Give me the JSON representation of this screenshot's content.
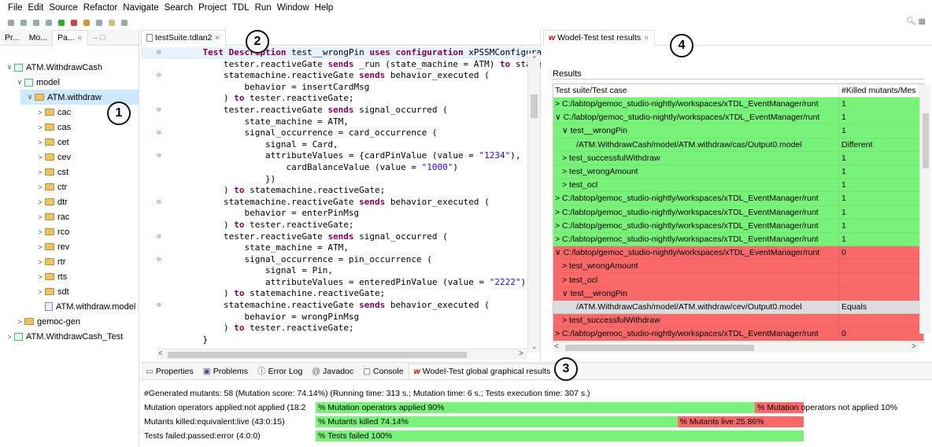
{
  "menu": [
    "File",
    "Edit",
    "Source",
    "Refactor",
    "Navigate",
    "Search",
    "Project",
    "TDL",
    "Run",
    "Window",
    "Help"
  ],
  "explorer": {
    "tabs": [
      "Pr...",
      "Mo...",
      "Pa..."
    ],
    "tree": [
      {
        "label": "ATM.WithdrawCash",
        "indent": 0,
        "chev": "∨",
        "icon": "project"
      },
      {
        "label": "model",
        "indent": 1,
        "chev": "∨",
        "icon": "package"
      },
      {
        "label": "ATM.withdraw",
        "indent": 2,
        "chev": "∨",
        "icon": "folder",
        "selected": true
      },
      {
        "label": "cac",
        "indent": 3,
        "chev": ">",
        "icon": "folder"
      },
      {
        "label": "cas",
        "indent": 3,
        "chev": ">",
        "icon": "folder"
      },
      {
        "label": "cet",
        "indent": 3,
        "chev": ">",
        "icon": "folder"
      },
      {
        "label": "cev",
        "indent": 3,
        "chev": ">",
        "icon": "folder"
      },
      {
        "label": "cst",
        "indent": 3,
        "chev": ">",
        "icon": "folder"
      },
      {
        "label": "ctr",
        "indent": 3,
        "chev": ">",
        "icon": "folder"
      },
      {
        "label": "dtr",
        "indent": 3,
        "chev": ">",
        "icon": "folder"
      },
      {
        "label": "rac",
        "indent": 3,
        "chev": ">",
        "icon": "folder"
      },
      {
        "label": "rco",
        "indent": 3,
        "chev": ">",
        "icon": "folder"
      },
      {
        "label": "rev",
        "indent": 3,
        "chev": ">",
        "icon": "folder"
      },
      {
        "label": "rtr",
        "indent": 3,
        "chev": ">",
        "icon": "folder"
      },
      {
        "label": "rts",
        "indent": 3,
        "chev": ">",
        "icon": "folder"
      },
      {
        "label": "sdt",
        "indent": 3,
        "chev": ">",
        "icon": "folder"
      },
      {
        "label": "ATM.withdraw.model",
        "indent": 3,
        "chev": "",
        "icon": "model"
      },
      {
        "label": "gemoc-gen",
        "indent": 1,
        "chev": ">",
        "icon": "folder"
      },
      {
        "label": "ATM.WithdrawCash_Test",
        "indent": 0,
        "chev": ">",
        "icon": "project"
      }
    ]
  },
  "badges": [
    "1",
    "2",
    "3",
    "4"
  ],
  "editor": {
    "tab": "testSuite.tdlan2",
    "lines": [
      [
        {
          "t": "    "
        },
        {
          "t": "Test Description",
          "k": 1
        },
        {
          "t": " test__wrongPin "
        },
        {
          "t": "uses configuration",
          "k": 1
        },
        {
          "t": " xPSSMConfigurat"
        }
      ],
      [
        {
          "t": "        tester.reactiveGate "
        },
        {
          "t": "sends",
          "k": 1
        },
        {
          "t": " _run (state_machine = ATM) "
        },
        {
          "t": "to",
          "k": 1
        },
        {
          "t": " statem"
        }
      ],
      [
        {
          "t": "        statemachine.reactiveGate "
        },
        {
          "t": "sends",
          "k": 1
        },
        {
          "t": " behavior_executed ("
        }
      ],
      [
        {
          "t": "            behavior = insertCardMsg"
        }
      ],
      [
        {
          "t": "        ) "
        },
        {
          "t": "to",
          "k": 1
        },
        {
          "t": " tester.reactiveGate;"
        }
      ],
      [
        {
          "t": "        tester.reactiveGate "
        },
        {
          "t": "sends",
          "k": 1
        },
        {
          "t": " signal_occurred ("
        }
      ],
      [
        {
          "t": "            state_machine = ATM,"
        }
      ],
      [
        {
          "t": "            signal_occurrence = card_occurrence ("
        }
      ],
      [
        {
          "t": "                signal = Card,"
        }
      ],
      [
        {
          "t": "                attributeValues = {cardPinValue (value = "
        },
        {
          "t": "\"1234\"",
          "s": 1
        },
        {
          "t": "),"
        }
      ],
      [
        {
          "t": "                    cardBalanceValue (value = "
        },
        {
          "t": "\"1000\"",
          "s": 1
        },
        {
          "t": ")"
        }
      ],
      [
        {
          "t": "                })"
        }
      ],
      [
        {
          "t": "        ) "
        },
        {
          "t": "to",
          "k": 1
        },
        {
          "t": " statemachine.reactiveGate;"
        }
      ],
      [
        {
          "t": "        statemachine.reactiveGate "
        },
        {
          "t": "sends",
          "k": 1
        },
        {
          "t": " behavior_executed ("
        }
      ],
      [
        {
          "t": "            behavior = enterPinMsg"
        }
      ],
      [
        {
          "t": "        ) "
        },
        {
          "t": "to",
          "k": 1
        },
        {
          "t": " tester.reactiveGate;"
        }
      ],
      [
        {
          "t": "        tester.reactiveGate "
        },
        {
          "t": "sends",
          "k": 1
        },
        {
          "t": " signal_occurred ("
        }
      ],
      [
        {
          "t": "            state_machine = ATM,"
        }
      ],
      [
        {
          "t": "            signal_occurrence = pin_occurrence ("
        }
      ],
      [
        {
          "t": "                signal = Pin,"
        }
      ],
      [
        {
          "t": "                attributeValues = enteredPinValue (value = "
        },
        {
          "t": "\"2222\"",
          "s": 1
        },
        {
          "t": "))"
        }
      ],
      [
        {
          "t": "        ) "
        },
        {
          "t": "to",
          "k": 1
        },
        {
          "t": " statemachine.reactiveGate;"
        }
      ],
      [
        {
          "t": "        statemachine.reactiveGate "
        },
        {
          "t": "sends",
          "k": 1
        },
        {
          "t": " behavior_executed ("
        }
      ],
      [
        {
          "t": "            behavior = wrongPinMsg"
        }
      ],
      [
        {
          "t": "        ) "
        },
        {
          "t": "to",
          "k": 1
        },
        {
          "t": " tester.reactiveGate;"
        }
      ],
      [
        {
          "t": "    }"
        }
      ]
    ],
    "gutter_marks": [
      0,
      2,
      5,
      7,
      9,
      13,
      16,
      18,
      22
    ]
  },
  "results": {
    "tab": "Wodel-Test test results",
    "section": "Results",
    "col1": "Test suite/Test case",
    "col2": "#Killed mutants/Mes",
    "rows": [
      {
        "c1": "> C:/labtop/gemoc_studio-nightly/workspaces/xTDL_EventManager/runt",
        "c2": "1",
        "color": "g",
        "indent": 0
      },
      {
        "c1": "∨ C:/labtop/gemoc_studio-nightly/workspaces/xTDL_EventManager/runt",
        "c2": "1",
        "color": "g",
        "indent": 0
      },
      {
        "c1": "∨ test__wrongPin",
        "c2": "1",
        "color": "g",
        "indent": 1
      },
      {
        "c1": "/ATM.WithdrawCash/model/ATM.withdraw/cas/Output0.model",
        "c2": "Different",
        "color": "g",
        "indent": 3
      },
      {
        "c1": "> test_successfulWithdraw",
        "c2": "1",
        "color": "g",
        "indent": 1
      },
      {
        "c1": "> test_wrongAmount",
        "c2": "1",
        "color": "g",
        "indent": 1
      },
      {
        "c1": "> test_ocl",
        "c2": "1",
        "color": "g",
        "indent": 1
      },
      {
        "c1": "> C:/labtop/gemoc_studio-nightly/workspaces/xTDL_EventManager/runt",
        "c2": "1",
        "color": "g",
        "indent": 0
      },
      {
        "c1": "> C:/labtop/gemoc_studio-nightly/workspaces/xTDL_EventManager/runt",
        "c2": "1",
        "color": "g",
        "indent": 0
      },
      {
        "c1": "> C:/labtop/gemoc_studio-nightly/workspaces/xTDL_EventManager/runt",
        "c2": "1",
        "color": "g",
        "indent": 0
      },
      {
        "c1": "> C:/labtop/gemoc_studio-nightly/workspaces/xTDL_EventManager/runt",
        "c2": "1",
        "color": "g",
        "indent": 0
      },
      {
        "c1": "∨ C:/labtop/gemoc_studio-nightly/workspaces/xTDL_EventManager/runt",
        "c2": "0",
        "color": "r",
        "indent": 0
      },
      {
        "c1": "> test_wrongAmount",
        "c2": "",
        "color": "r",
        "indent": 1
      },
      {
        "c1": "> test_ocl",
        "c2": "",
        "color": "r",
        "indent": 1
      },
      {
        "c1": "∨ test__wrongPin",
        "c2": "",
        "color": "r",
        "indent": 1
      },
      {
        "c1": "/ATM.WithdrawCash/model/ATM.withdraw/cev/Output0.model",
        "c2": "Equals",
        "color": "gr",
        "indent": 3
      },
      {
        "c1": "> test_successfulWithdraw",
        "c2": "",
        "color": "r",
        "indent": 1
      },
      {
        "c1": "> C:/labtop/gemoc_studio-nightly/workspaces/xTDL_EventManager/runt",
        "c2": "0",
        "color": "r",
        "indent": 0
      }
    ]
  },
  "bottom": {
    "tabs": [
      "Properties",
      "Problems",
      "Error Log",
      "Javadoc",
      "Console",
      "Wodel-Test global graphical results"
    ],
    "summary": "#Generated mutants: 58 (Mutation score: 74.14%) (Running time: 313 s.; Mutation time: 6 s.; Tests execution time: 307 s.)",
    "bars": [
      {
        "label": "Mutation operators applied:not applied (18:2",
        "green_text": "% Mutation operators applied 90%",
        "red_text": "% Mutation operators not applied 10%",
        "green_frac": 0.9
      },
      {
        "label": "Mutants killed:equivalent:live (43:0:15)",
        "green_text": "% Mutants killed 74.14%",
        "red_text": "% Mutants live 25.86%",
        "green_frac": 0.7414
      },
      {
        "label": "Tests failed:passed:error (4:0:0)",
        "green_text": "% Tests failed 100%",
        "red_text": "",
        "green_frac": 1.0
      }
    ]
  },
  "colors": {
    "green": "#78f278",
    "red": "#fa6969",
    "selection": "#cde8ff",
    "keyword": "#7f0055",
    "string": "#2a00ff"
  }
}
